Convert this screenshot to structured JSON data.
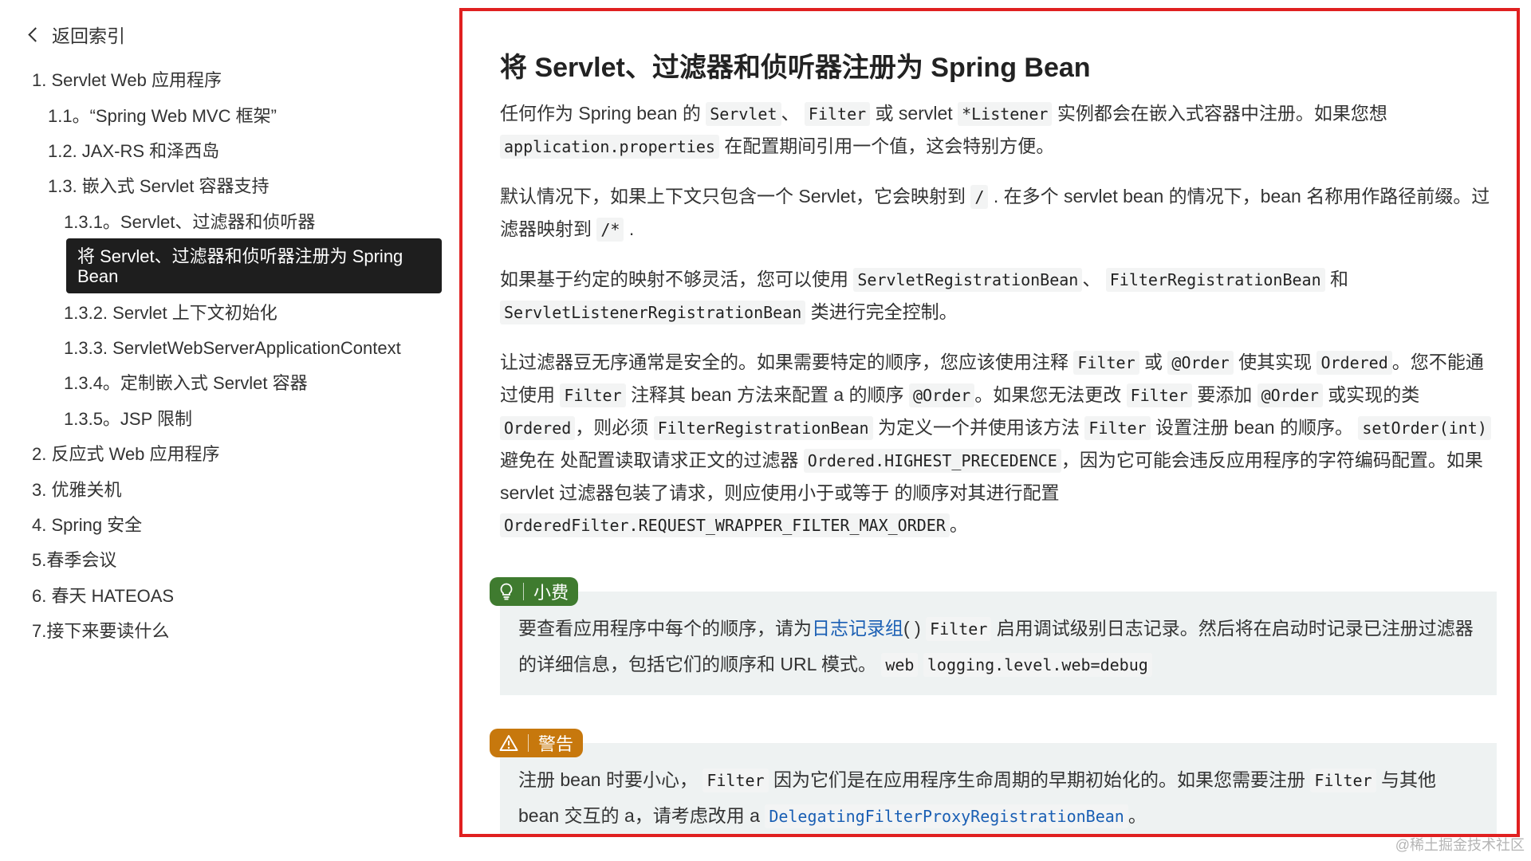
{
  "sidebar": {
    "back_label": "返回索引",
    "items": [
      {
        "label": "1. Servlet Web 应用程序"
      },
      {
        "label": "1.1。“Spring Web MVC 框架”"
      },
      {
        "label": "1.2. JAX-RS 和泽西岛"
      },
      {
        "label": "1.3. 嵌入式 Servlet 容器支持"
      },
      {
        "label": "1.3.1。Servlet、过滤器和侦听器"
      },
      {
        "label": "将 Servlet、过滤器和侦听器注册为 Spring Bean"
      },
      {
        "label": "1.3.2. Servlet 上下文初始化"
      },
      {
        "label": "1.3.3. ServletWebServerApplicationContext"
      },
      {
        "label": "1.3.4。定制嵌入式 Servlet 容器"
      },
      {
        "label": "1.3.5。JSP 限制"
      },
      {
        "label": "2. 反应式 Web 应用程序"
      },
      {
        "label": "3. 优雅关机"
      },
      {
        "label": "4. Spring 安全"
      },
      {
        "label": "5.春季会议"
      },
      {
        "label": "6. 春天 HATEOAS"
      },
      {
        "label": "7.接下来要读什么"
      }
    ]
  },
  "content": {
    "title": "将 Servlet、过滤器和侦听器注册为 Spring Bean",
    "p1": {
      "t1": "任何作为 Spring bean 的",
      "c1": "Servlet",
      "t2": "、",
      "c2": "Filter",
      "t3": "或 servlet",
      "c3": "*Listener",
      "t4": "实例都会在嵌入式容器中注册。如果您想",
      "c4": "application.properties",
      "t5": "在配置期间引用一个值，这会特别方便。"
    },
    "p2": {
      "t1": "默认情况下，如果上下文只包含一个 Servlet，它会映射到",
      "c1": "/",
      "t2": ". 在多个 servlet bean 的情况下，bean 名称用作路径前缀。过滤器映射到",
      "c2": "/*",
      "t3": "."
    },
    "p3": {
      "t1": "如果基于约定的映射不够灵活，您可以使用",
      "c1": "ServletRegistrationBean",
      "t2": "、",
      "c2": "FilterRegistrationBean",
      "t3": "和",
      "c3": "ServletListenerRegistrationBean",
      "t4": "类进行完全控制。"
    },
    "p4": {
      "t1": "让过滤器豆无序通常是安全的。如果需要特定的顺序，您应该使用注释",
      "c1": "Filter",
      "t2": "或",
      "c2": "@Order",
      "t3": "使其实现",
      "c3": "Ordered",
      "t4": "。您不能通过使用",
      "c4": "Filter",
      "t5": "注释其 bean 方法来配置 a 的顺序",
      "c5": "@Order",
      "t6": "。如果您无法更改",
      "c6": "Filter",
      "t7": "要添加",
      "c7": "@Order",
      "t8": "或实现的类",
      "c8": "Ordered",
      "t9": "，则必须",
      "c9": "FilterRegistrationBean",
      "t10": "为定义一个并使用该方法",
      "c10": "Filter",
      "t11": "设置注册 bean 的顺序。",
      "c11": "setOrder(int)",
      "t12": "避免在 处配置读取请求正文的过滤器",
      "c12": "Ordered.HIGHEST_PRECEDENCE",
      "t13": "，因为它可能会违反应用程序的字符编码配置。如果 servlet 过滤器包装了请求，则应使用小于或等于 的顺序对其进行配置",
      "c13": "OrderedFilter.REQUEST_WRAPPER_FILTER_MAX_ORDER",
      "t14": "。"
    },
    "tip": {
      "label": "小费",
      "t1": "要查看应用程序中每个的顺序，请为",
      "link": "日志记录组",
      "t2": "( )",
      "c1": "Filter",
      "t3": "启用调试级别日志记录。然后将在启动时记录已注册过滤器的详细信息，包括它们的顺序和 URL 模式。",
      "c2": "web",
      "c3": "logging.level.web=debug"
    },
    "warning": {
      "label": "警告",
      "t1": "注册 bean 时要小心，",
      "c1": "Filter",
      "t2": "因为它们是在应用程序生命周期的早期初始化的。如果您需要注册",
      "c2": "Filter",
      "t3": "与其他 bean 交互的 a，请考虑改用 a",
      "link": "DelegatingFilterProxyRegistrationBean",
      "t4": "。"
    }
  },
  "watermark": "@稀土掘金技术社区",
  "colors": {
    "tip": "#3f7b2f",
    "warning": "#c7780d",
    "frame": "#e02020",
    "active": "#1e1e1e"
  }
}
